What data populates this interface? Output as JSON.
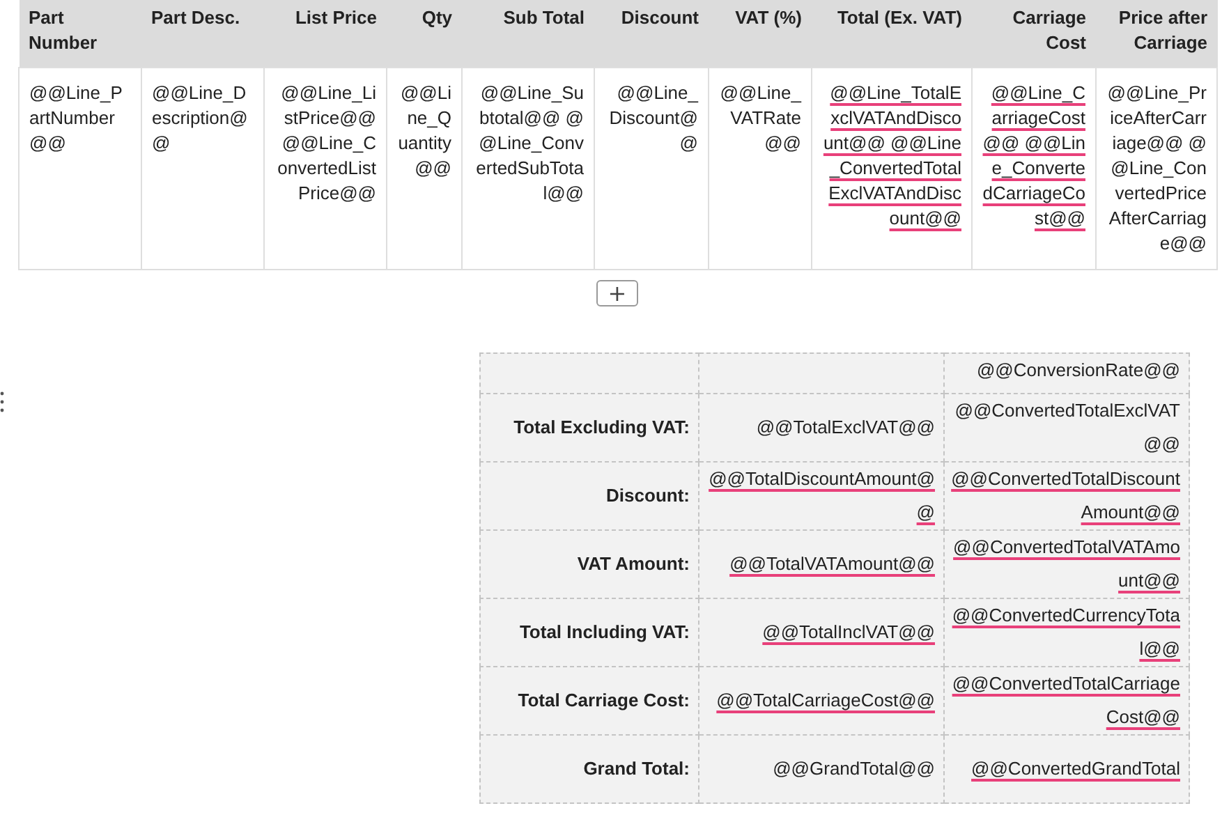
{
  "line_table": {
    "columns": [
      "Part Number",
      "Part Desc.",
      "List Price",
      "Qty",
      "Sub Total",
      "Discount",
      "VAT (%)",
      "Total (Ex. VAT)",
      "Carriage Cost",
      "Price after Carriage"
    ],
    "rows": [
      {
        "cells": [
          {
            "text": "@@Line_PartNumber@@",
            "spelling_flag": false
          },
          {
            "text": "@@Line_Description@@",
            "spelling_flag": false
          },
          {
            "text": "@@Line_ListPrice@@ @@Line_ConvertedListPrice@@",
            "spelling_flag": false
          },
          {
            "text": "@@Line_Quantity@@",
            "spelling_flag": false
          },
          {
            "text": "@@Line_Subtotal@@ @@Line_ConvertedSubTotal@@",
            "spelling_flag": false
          },
          {
            "text": "@@Line_Discount@@",
            "spelling_flag": false
          },
          {
            "text": "@@Line_VATRate@@",
            "spelling_flag": false
          },
          {
            "text": "@@Line_TotalExclVATAndDiscount@@ @@Line_ConvertedTotalExclVATAndDiscount@@",
            "spelling_flag": true
          },
          {
            "text": "@@Line_CarriageCost@@ @@Line_ConvertedCarriageCost@@",
            "spelling_flag": true
          },
          {
            "text": "@@Line_PriceAfterCarriage@@ @@Line_ConvertedPriceAfterCarriage@@",
            "spelling_flag": false
          }
        ]
      }
    ]
  },
  "add_row_button": {
    "label": "+"
  },
  "summary_table": {
    "rows": [
      {
        "converted": {
          "text": "@@ConversionRate@@",
          "spelling_flag": false
        }
      },
      {
        "label": "Total Excluding VAT:",
        "value": {
          "text": "@@TotalExclVAT@@",
          "spelling_flag": false
        },
        "converted": {
          "text": "@@ConvertedTotalExclVAT@@",
          "spelling_flag": false
        }
      },
      {
        "label": "Discount:",
        "value": {
          "text": "@@TotalDiscountAmount@@",
          "spelling_flag": true
        },
        "converted": {
          "text": "@@ConvertedTotalDiscountAmount@@",
          "spelling_flag": true
        }
      },
      {
        "label": "VAT Amount:",
        "value": {
          "text": "@@TotalVATAmount@@",
          "spelling_flag": true
        },
        "converted": {
          "text": "@@ConvertedTotalVATAmount@@",
          "spelling_flag": true
        }
      },
      {
        "label": "Total Including VAT:",
        "value": {
          "text": "@@TotalInclVAT@@",
          "spelling_flag": true
        },
        "converted": {
          "text": "@@ConvertedCurrencyTotal@@",
          "spelling_flag": true
        }
      },
      {
        "label": "Total Carriage Cost:",
        "value": {
          "text": "@@TotalCarriageCost@@",
          "spelling_flag": true
        },
        "converted": {
          "text": "@@ConvertedTotalCarriageCost@@",
          "spelling_flag": true
        }
      },
      {
        "label": "Grand Total:",
        "value": {
          "text": "@@GrandTotal@@",
          "spelling_flag": false
        },
        "converted": {
          "text": "@@ConvertedGrandTotal",
          "spelling_flag": true
        }
      }
    ]
  }
}
